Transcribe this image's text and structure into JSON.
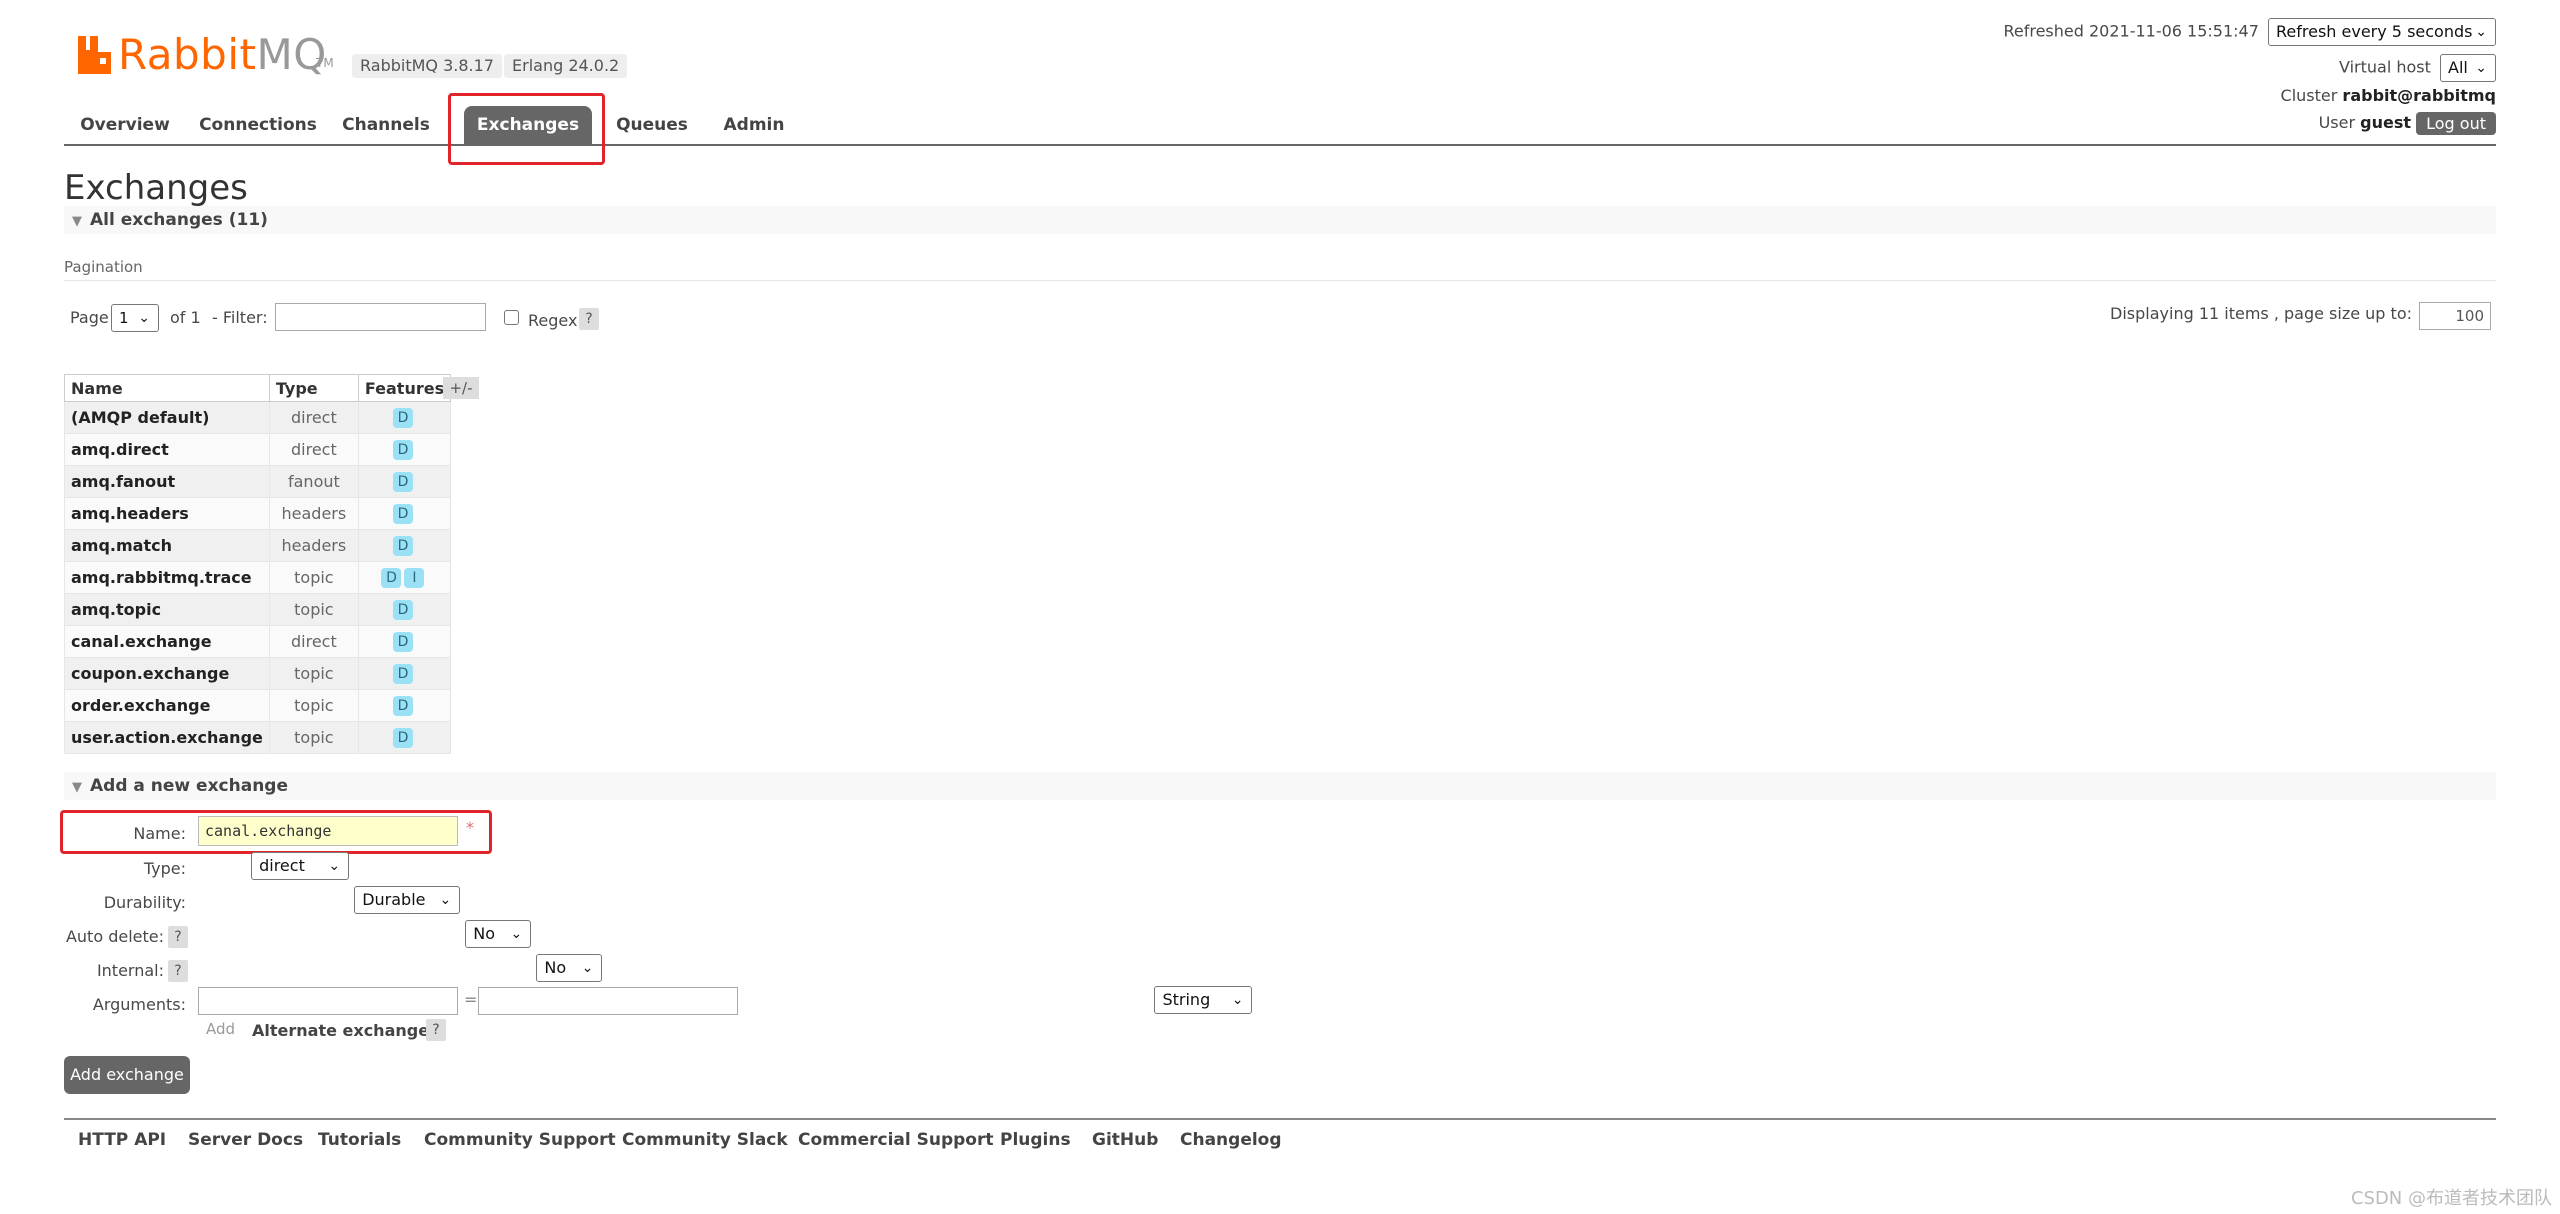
{
  "app": {
    "logo_part1": "Rabbit",
    "logo_part2": "MQ",
    "logo_tm": "TM",
    "version_badge": "RabbitMQ 3.8.17",
    "erlang_badge": "Erlang 24.0.2",
    "brand_color": "#ff6600"
  },
  "nav": {
    "tabs": [
      "Overview",
      "Connections",
      "Channels",
      "Exchanges",
      "Queues",
      "Admin"
    ],
    "active": "Exchanges"
  },
  "status": {
    "refreshed": "Refreshed 2021-11-06 15:51:47",
    "refresh_select": "Refresh every 5 seconds",
    "vhost_label": "Virtual host",
    "vhost_select": "All",
    "cluster_label": "Cluster",
    "cluster_name": "rabbit@rabbitmq",
    "user_label": "User",
    "user_name": "guest",
    "logout": "Log out"
  },
  "page": {
    "title": "Exchanges",
    "all_section": "All exchanges (11)",
    "pagination_label": "Pagination",
    "page_label": "Page",
    "page_select": "1",
    "of_label": "of 1",
    "filter_label": "- Filter:",
    "filter_value": "",
    "regex_label": "Regex",
    "help": "?",
    "displaying": "Displaying 11 items , page size up to:",
    "page_size": "100"
  },
  "table": {
    "headers": [
      "Name",
      "Type",
      "Features"
    ],
    "toggle": "+/-",
    "rows": [
      {
        "name": "(AMQP default)",
        "type": "direct",
        "features": [
          "D"
        ]
      },
      {
        "name": "amq.direct",
        "type": "direct",
        "features": [
          "D"
        ]
      },
      {
        "name": "amq.fanout",
        "type": "fanout",
        "features": [
          "D"
        ]
      },
      {
        "name": "amq.headers",
        "type": "headers",
        "features": [
          "D"
        ]
      },
      {
        "name": "amq.match",
        "type": "headers",
        "features": [
          "D"
        ]
      },
      {
        "name": "amq.rabbitmq.trace",
        "type": "topic",
        "features": [
          "D",
          "I"
        ]
      },
      {
        "name": "amq.topic",
        "type": "topic",
        "features": [
          "D"
        ]
      },
      {
        "name": "canal.exchange",
        "type": "direct",
        "features": [
          "D"
        ]
      },
      {
        "name": "coupon.exchange",
        "type": "topic",
        "features": [
          "D"
        ]
      },
      {
        "name": "order.exchange",
        "type": "topic",
        "features": [
          "D"
        ]
      },
      {
        "name": "user.action.exchange",
        "type": "topic",
        "features": [
          "D"
        ]
      }
    ]
  },
  "form": {
    "section": "Add a new exchange",
    "name_label": "Name:",
    "name_value": "canal.exchange",
    "required": "*",
    "type_label": "Type:",
    "type_value": "direct",
    "durability_label": "Durability:",
    "durability_value": "Durable",
    "auto_delete_label": "Auto delete:",
    "auto_delete_value": "No",
    "internal_label": "Internal:",
    "internal_value": "No",
    "arguments_label": "Arguments:",
    "equals": "=",
    "arg_type": "String",
    "add_link": "Add",
    "alt_exchange": "Alternate exchange",
    "submit": "Add exchange"
  },
  "footer": {
    "links": [
      "HTTP API",
      "Server Docs",
      "Tutorials",
      "Community Support",
      "Community Slack",
      "Commercial Support",
      "Plugins",
      "GitHub",
      "Changelog"
    ]
  },
  "watermark": "CSDN @布道者技术团队"
}
